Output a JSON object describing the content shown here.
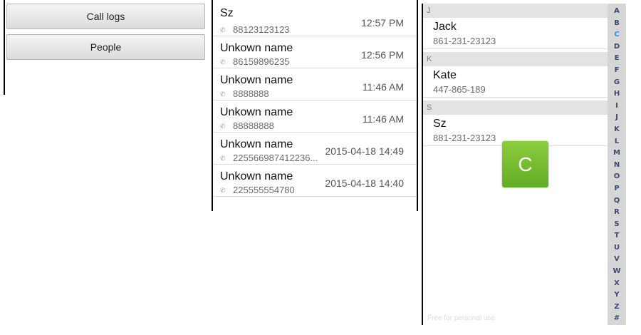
{
  "menu": {
    "call_logs_label": "Call logs",
    "people_label": "People"
  },
  "call_logs": [
    {
      "name": "Sz",
      "number": "88123123123",
      "time": "12:57 PM"
    },
    {
      "name": "Unkown name",
      "number": "86159896235",
      "time": "12:56 PM"
    },
    {
      "name": "Unkown name",
      "number": "8888888",
      "time": "11:46 AM"
    },
    {
      "name": "Unkown name",
      "number": "88888888",
      "time": "11:46 AM"
    },
    {
      "name": "Unkown name",
      "number": "225566987412236...",
      "time": "2015-04-18 14:49"
    },
    {
      "name": "Unkown name",
      "number": "225555554780",
      "time": "2015-04-18 14:40"
    }
  ],
  "contacts": {
    "sections": [
      {
        "letter": "J",
        "name": "Jack",
        "phone": "861-231-23123"
      },
      {
        "letter": "K",
        "name": "Kate",
        "phone": "447-865-189"
      },
      {
        "letter": "S",
        "name": "Sz",
        "phone": "881-231-23123"
      }
    ],
    "watermark": "Free for personal use"
  },
  "letter_toast": "C",
  "index_bar": {
    "letters": [
      "A",
      "B",
      "C",
      "D",
      "E",
      "F",
      "G",
      "H",
      "I",
      "J",
      "K",
      "L",
      "M",
      "N",
      "O",
      "P",
      "Q",
      "R",
      "S",
      "T",
      "U",
      "V",
      "W",
      "X",
      "Y",
      "Z",
      "#"
    ],
    "active": "C",
    "active_color": "#2f8ee8"
  },
  "icons": {
    "call_row_icon": "phone-icon",
    "phone_glyph": "✆"
  },
  "colors": {
    "toast_green": "#7cbf34",
    "index_background": "#d6d6d6"
  }
}
